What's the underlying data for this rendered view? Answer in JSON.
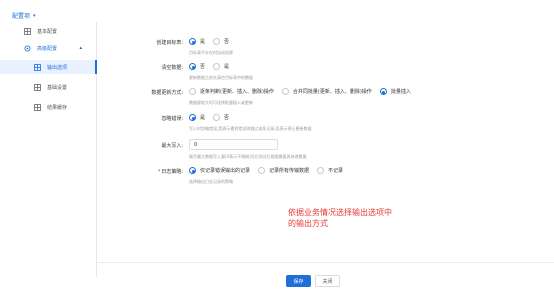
{
  "header": {
    "title": "配置项",
    "chevron_icon": "chevron-down-icon"
  },
  "sidebar": {
    "items": [
      {
        "label": "基本配置",
        "icon": "grid-icon"
      },
      {
        "label": "高级配置",
        "icon": "settings-icon"
      },
      {
        "label": "输出选项",
        "icon": "grid-icon"
      },
      {
        "label": "基础设置",
        "icon": "grid-icon"
      },
      {
        "label": "结果缓存",
        "icon": "grid-icon"
      }
    ]
  },
  "form": {
    "create_table": {
      "label": "创建目标表:",
      "options": [
        "是",
        "否"
      ],
      "selected": 0,
      "hint": "目标表不存在时自动创建"
    },
    "clear_data": {
      "label": "清空数据:",
      "options": [
        "否",
        "是"
      ],
      "selected": 0,
      "hint": "更新数据之前先清空目标表中的数据"
    },
    "update_mode": {
      "label": "数据更新方式:",
      "options": [
        "逐条判断(更新、插入、删除)操作",
        "合并同批量(更新、插入、删除)操作",
        "批量插入"
      ],
      "selected": 2,
      "hint": "数据量较大时可选择批量插入或更新"
    },
    "ignore_error": {
      "label": "忽略错误:",
      "options": [
        "是",
        "否"
      ],
      "selected": 0,
      "hint": "写入时忽略错误,是表示遇到错误则跳过该条记录,否表示停止更新数据"
    },
    "max_write": {
      "label": "最大写入:",
      "value": "0",
      "hint": "填写最大数据写入量(0表示不限制)可在测试后根据需要再修改数量"
    },
    "log_policy": {
      "label": "日志策略:",
      "required_mark": "*",
      "options": [
        "仅记录错误输出的记录",
        "记录所有传输数据",
        "不记录"
      ],
      "selected": 0,
      "hint": "选择输出日志记录的策略"
    }
  },
  "annotation": "依据业务情况选择输出选项中的输出方式",
  "footer": {
    "save_label": "保存",
    "close_label": "关闭"
  },
  "colors": {
    "accent": "#1e6fd9",
    "annotation": "#e53935"
  }
}
